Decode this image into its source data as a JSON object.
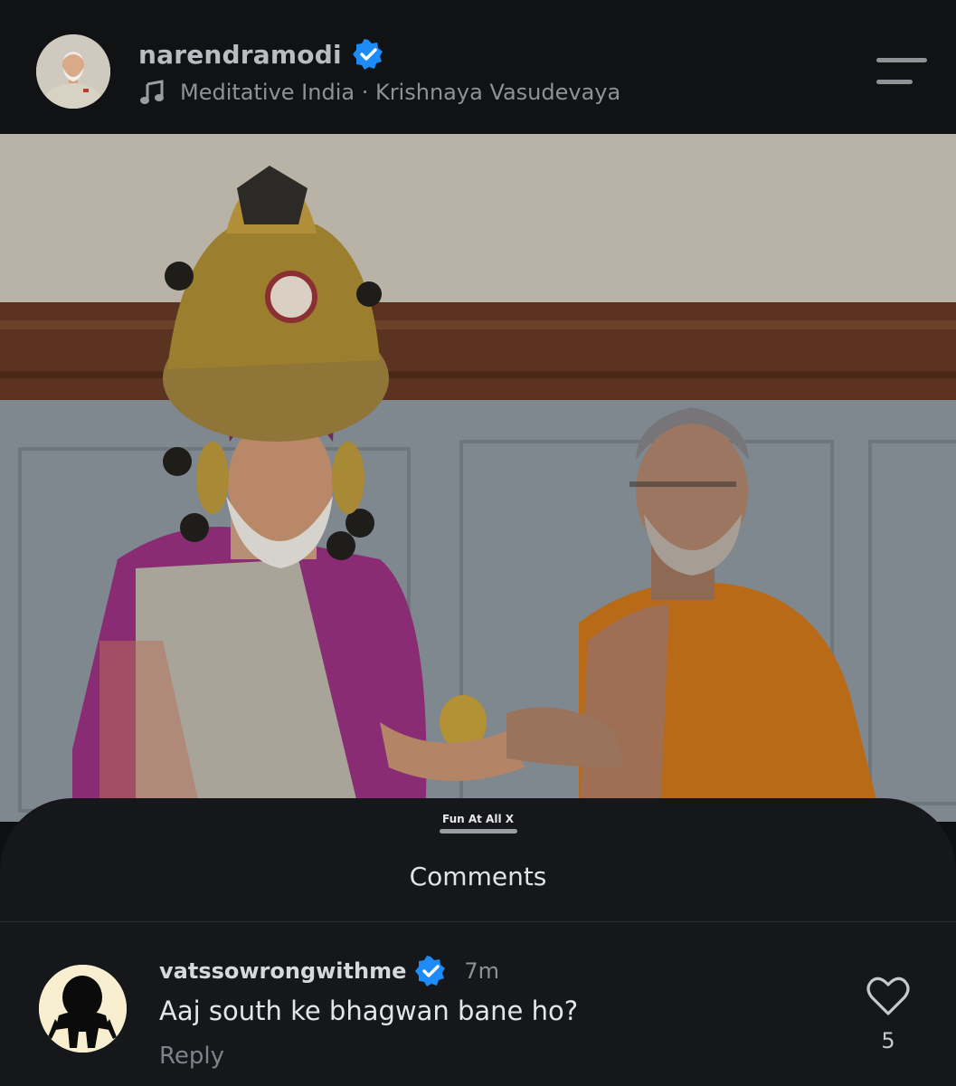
{
  "header": {
    "username": "narendramodi",
    "audio_label": "Meditative India · Krishnaya Vasudevaya"
  },
  "sheet": {
    "watermark": "Fun At All X",
    "title": "Comments"
  },
  "comments": [
    {
      "username": "vatssowrongwithme",
      "time": "7m",
      "text": "Aaj south ke bhagwan bane ho?",
      "reply_label": "Reply",
      "likes": "5"
    }
  ],
  "colors": {
    "verified": "#1d8cf8",
    "background": "#0e0f11",
    "sheet": "#16171a"
  },
  "icons": [
    "verified-icon",
    "music-note-icon",
    "menu-icon",
    "heart-icon"
  ]
}
